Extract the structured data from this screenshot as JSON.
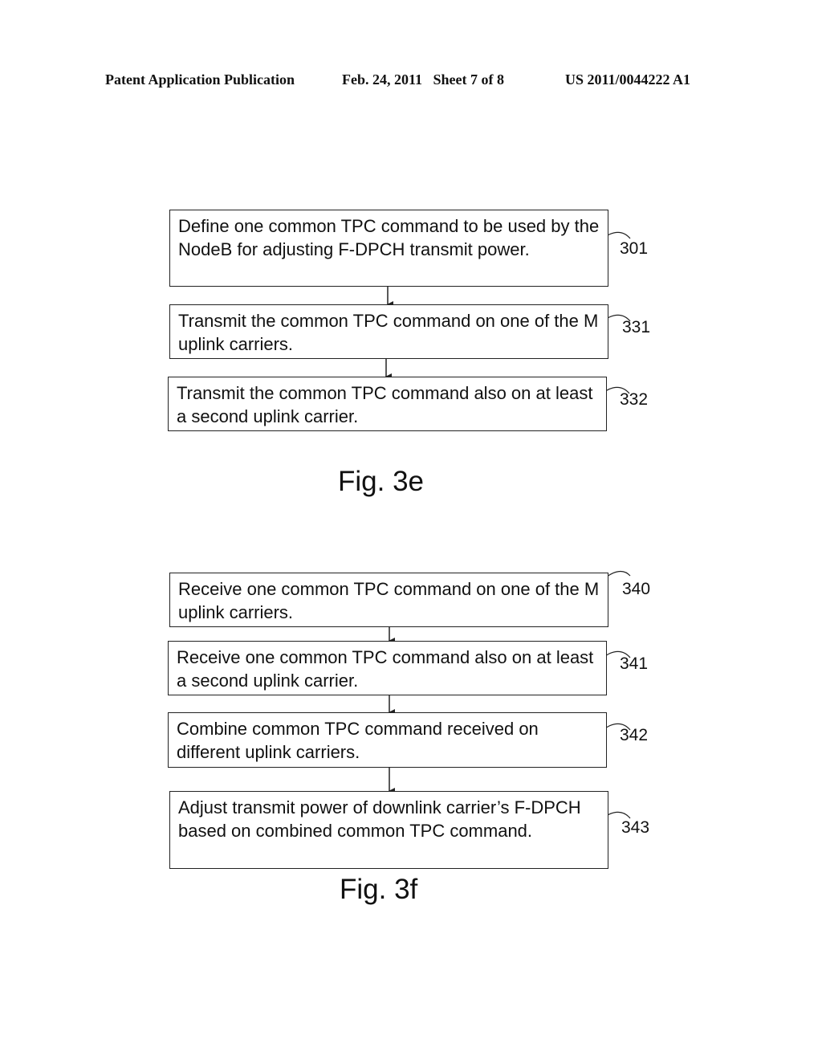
{
  "header": {
    "publication": "Patent Application Publication",
    "date_sheet": "Feb. 24, 2011   Sheet 7 of 8",
    "number": "US 2011/0044222 A1"
  },
  "figures": [
    {
      "label": "Fig. 3e",
      "steps": [
        {
          "ref": "301",
          "text": "Define one common TPC command to be used by the NodeB for adjusting F-DPCH transmit power."
        },
        {
          "ref": "331",
          "text": "Transmit the common TPC command on one of the M uplink carriers."
        },
        {
          "ref": "332",
          "text": "Transmit the common TPC command also on at least a second uplink carrier."
        }
      ]
    },
    {
      "label": "Fig. 3f",
      "steps": [
        {
          "ref": "340",
          "text": "Receive one common TPC command on one of the M uplink carriers."
        },
        {
          "ref": "341",
          "text": "Receive one common TPC command also on at least a second uplink carrier."
        },
        {
          "ref": "342",
          "text": "Combine common TPC command received on different uplink carriers."
        },
        {
          "ref": "343",
          "text": "Adjust transmit power of downlink carrier’s F-DPCH based on combined common TPC command."
        }
      ]
    }
  ]
}
